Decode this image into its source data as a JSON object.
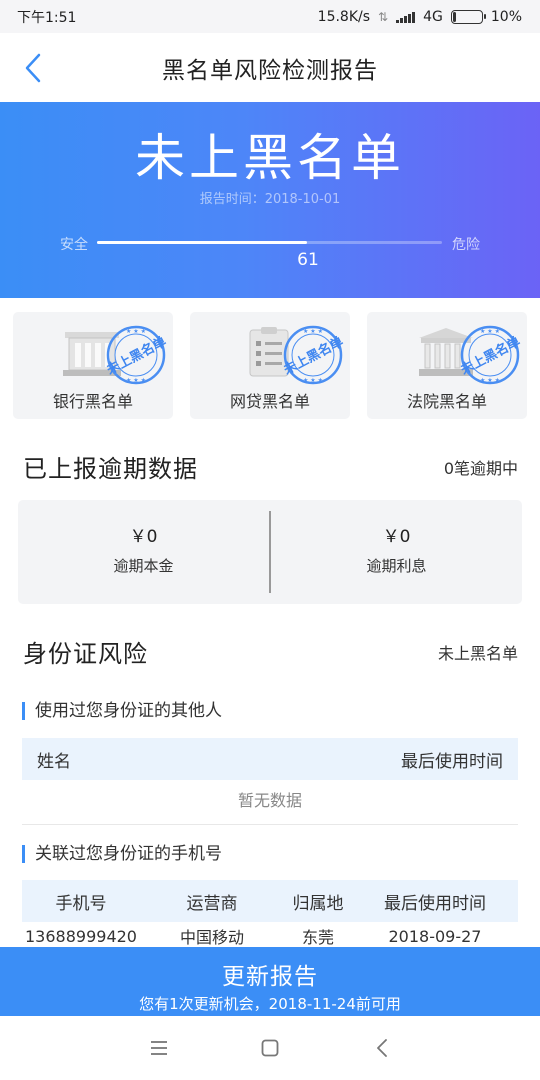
{
  "status_bar": {
    "time": "下午1:51",
    "net_speed": "15.8K/s",
    "network": "4G",
    "battery": "10%",
    "battery_level": 0.1
  },
  "header": {
    "title": "黑名单风险检测报告",
    "back_icon": "chevron-left-icon"
  },
  "hero": {
    "status": "未上黑名单",
    "report_label": "报告时间",
    "report_date": "：2018-10-01",
    "safe_label": "安全",
    "danger_label": "危险",
    "score": "61",
    "score_fraction": 0.61
  },
  "blacklist_cards": [
    {
      "label": "银行黑名单",
      "icon": "bank-icon",
      "stamp": "未上黑名单"
    },
    {
      "label": "网贷黑名单",
      "icon": "clipboard-icon",
      "stamp": "未上黑名单"
    },
    {
      "label": "法院黑名单",
      "icon": "courthouse-icon",
      "stamp": "未上黑名单"
    }
  ],
  "overdue": {
    "title": "已上报逾期数据",
    "summary": "0笔逾期中",
    "principal": {
      "amount": "￥0",
      "label": "逾期本金"
    },
    "interest": {
      "amount": "￥0",
      "label": "逾期利息"
    }
  },
  "id_risk": {
    "title": "身份证风险",
    "status": "未上黑名单",
    "others_title": "使用过您身份证的其他人",
    "others_headers": [
      "姓名",
      "最后使用时间"
    ],
    "others_empty": "暂无数据",
    "phones_title": "关联过您身份证的手机号",
    "phones_headers": [
      "手机号",
      "运营商",
      "归属地",
      "最后使用时间"
    ],
    "phones_rows": [
      [
        "13688999420",
        "中国移动",
        "东莞",
        "2018-09-27"
      ]
    ]
  },
  "update": {
    "title": "更新报告",
    "subtitle": "您有1次更新机会，2018-11-24前可用"
  },
  "colors": {
    "accent": "#3b8ef6",
    "gradient_start": "#3b8ef6",
    "gradient_end": "#6b63f6",
    "card_bg": "#f3f4f6",
    "table_head_bg": "#eaf3fd"
  }
}
